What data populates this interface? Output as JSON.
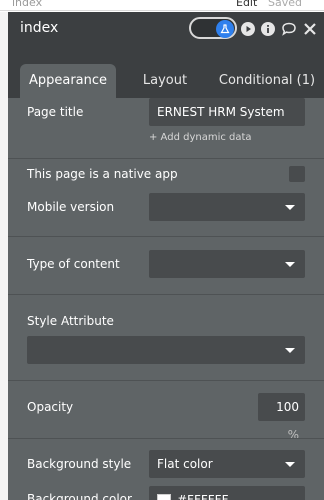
{
  "behind": {
    "page_name": "index",
    "edit_label": "Edit",
    "saved_label": "Saved"
  },
  "panel": {
    "title": "index",
    "tabs": [
      {
        "label": "Appearance",
        "active": true
      },
      {
        "label": "Layout",
        "active": false
      },
      {
        "label": "Conditional (1)",
        "active": false
      }
    ],
    "page_title": {
      "label": "Page title",
      "value": "ERNEST HRM System",
      "dynamic": "+ Add dynamic data"
    },
    "native_app": {
      "label": "This page is a native app"
    },
    "mobile_version": {
      "label": "Mobile version",
      "value": ""
    },
    "type_of_content": {
      "label": "Type of content",
      "value": ""
    },
    "style_attribute": {
      "label": "Style Attribute",
      "value": ""
    },
    "opacity": {
      "label": "Opacity",
      "value": "100",
      "unit": "%"
    },
    "background_style": {
      "label": "Background style",
      "value": "Flat color"
    },
    "background_color": {
      "label": "Background color",
      "value": "#FFFFFF"
    }
  },
  "colors": {
    "panel_bg": "#5f6466",
    "header_bg": "#3c3f41",
    "field_bg": "#484b4d",
    "accent": "#2f80ed"
  },
  "icons": [
    "flask-icon",
    "play-icon",
    "info-icon",
    "comment-icon",
    "close-icon",
    "chevron-down-icon",
    "plus-icon"
  ]
}
